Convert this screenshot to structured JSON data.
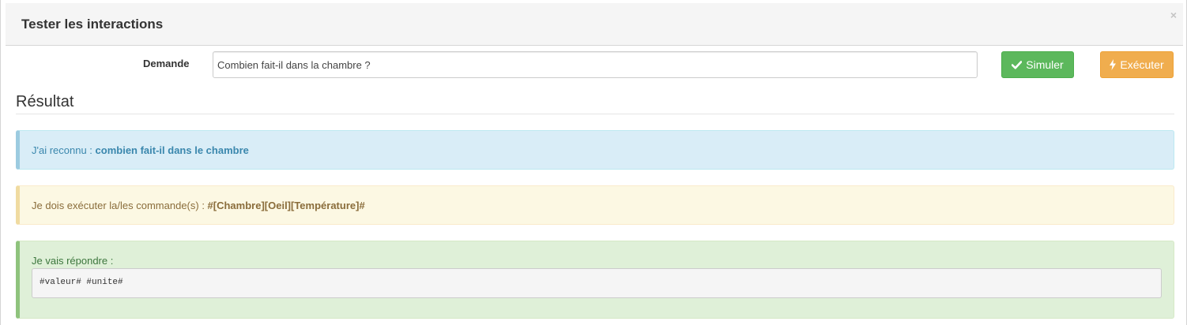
{
  "modal": {
    "title": "Tester les interactions",
    "close_label": "×"
  },
  "form": {
    "request_label": "Demande",
    "request_value": "Combien fait-il dans la chambre ?"
  },
  "buttons": {
    "simulate_label": "Simuler",
    "simulate_icon": "check-icon",
    "execute_label": "Exécuter",
    "execute_icon": "bolt-icon"
  },
  "result": {
    "title": "Résultat",
    "recognized_prefix": "J'ai reconnu : ",
    "recognized_value": "combien fait-il dans le chambre",
    "commands_prefix": "Je dois exécuter la/les commande(s) : ",
    "commands_value": "#[Chambre][Oeil][Température]#",
    "answer_prefix": "Je vais répondre :",
    "answer_value": "#valeur# #unite#"
  },
  "colors": {
    "simulate": "#5cb85c",
    "execute": "#f0ad4e",
    "info_bg": "#d9edf7",
    "warning_bg": "#fcf8e3",
    "success_bg": "#dff0d8"
  }
}
